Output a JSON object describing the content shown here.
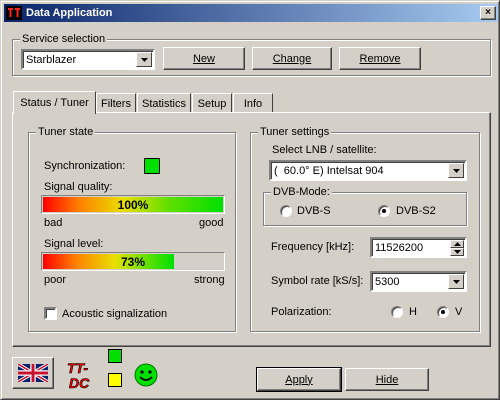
{
  "window": {
    "title": "Data Application",
    "close_glyph": "×"
  },
  "service": {
    "legend": "Service selection",
    "selected": "Starblazer",
    "buttons": {
      "new": "New",
      "change": "Change",
      "remove": "Remove"
    }
  },
  "tabs": [
    "Status / Tuner",
    "Filters",
    "Statistics",
    "Setup",
    "Info"
  ],
  "tuner_state": {
    "legend": "Tuner state",
    "sync_label": "Synchronization:",
    "sync_color": "#00e000",
    "quality_label": "Signal quality:",
    "quality_value": 100,
    "quality_text": "100%",
    "quality_min": "bad",
    "quality_max": "good",
    "level_label": "Signal level:",
    "level_value": 73,
    "level_text": "73%",
    "level_min": "poor",
    "level_max": "strong",
    "acoustic_label": "Acoustic signalization",
    "acoustic_checked": false
  },
  "tuner_settings": {
    "legend": "Tuner settings",
    "lnb_label": "Select LNB / satellite:",
    "lnb_value": "(  60.0° E) Intelsat 904",
    "mode_legend": "DVB-Mode:",
    "mode_options": [
      "DVB-S",
      "DVB-S2"
    ],
    "mode_selected": "DVB-S2",
    "freq_label": "Frequency [kHz]:",
    "freq_value": "11526200",
    "symbol_label": "Symbol rate [kS/s]:",
    "symbol_value": "5300",
    "pol_label": "Polarization:",
    "pol_options": [
      "H",
      "V"
    ],
    "pol_selected": "V"
  },
  "footer": {
    "apply": "Apply",
    "hide": "Hide",
    "logo_text": "TT-DC",
    "led_top_color": "#00e000",
    "led_bottom_color": "#ffff00"
  }
}
